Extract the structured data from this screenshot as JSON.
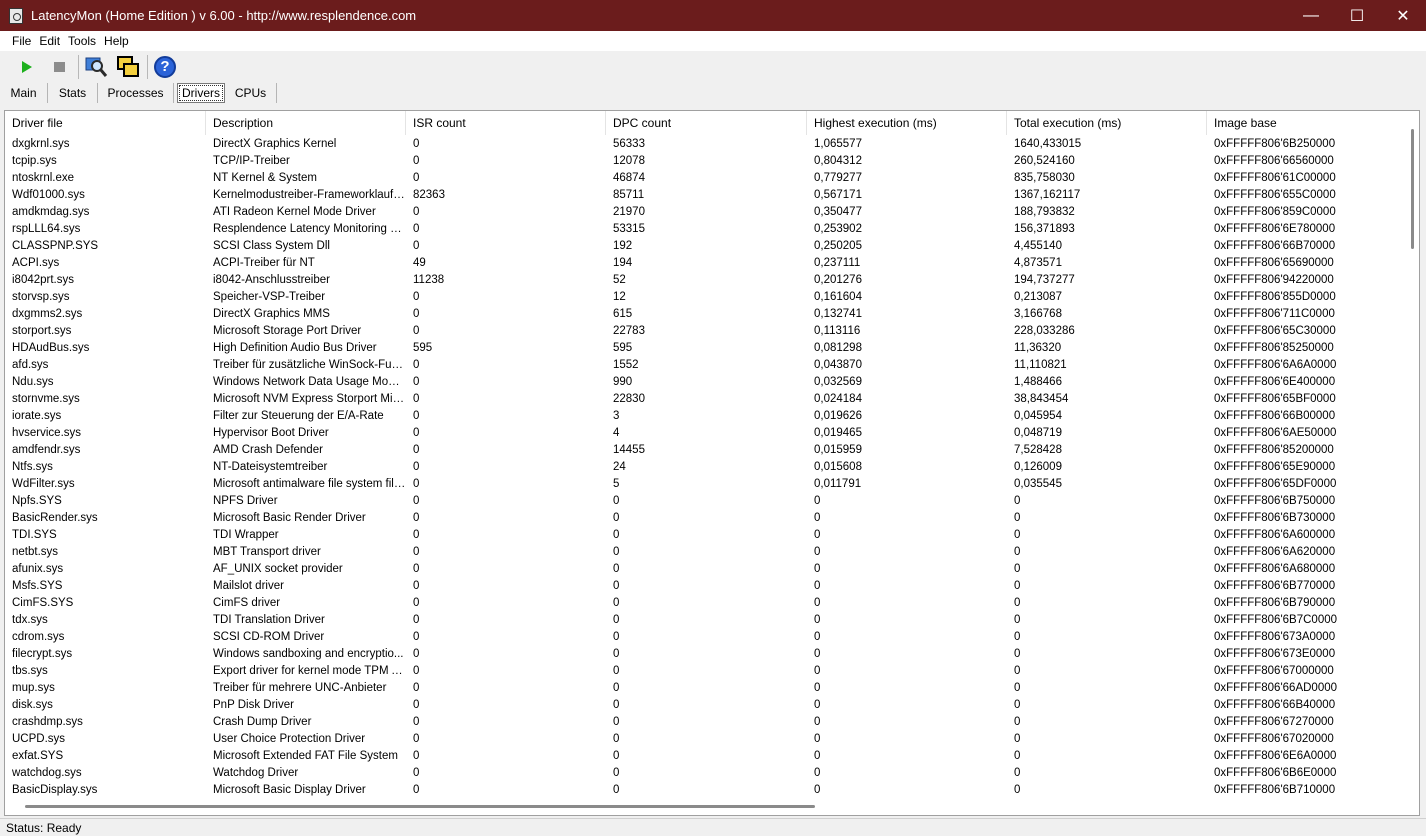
{
  "window": {
    "title": "LatencyMon  (Home Edition )  v 6.00 - http://www.resplendence.com",
    "controls": {
      "minimize": "—",
      "maximize": "☐",
      "close": "✕"
    }
  },
  "menu": [
    {
      "label": "File"
    },
    {
      "label": "Edit"
    },
    {
      "label": "Tools"
    },
    {
      "label": "Help"
    }
  ],
  "toolbar": {
    "icons": [
      "play-icon",
      "stop-icon",
      "search-icon",
      "windows-icon",
      "help-icon"
    ],
    "help_glyph": "?"
  },
  "tabs": [
    {
      "label": "Main",
      "active": false
    },
    {
      "label": "Stats",
      "active": false
    },
    {
      "label": "Processes",
      "active": false
    },
    {
      "label": "Drivers",
      "active": true
    },
    {
      "label": "CPUs",
      "active": false
    }
  ],
  "table": {
    "columns": [
      "Driver file",
      "Description",
      "ISR count",
      "DPC count",
      "Highest execution (ms)",
      "Total execution (ms)",
      "Image base"
    ],
    "rows": [
      [
        "dxgkrnl.sys",
        "DirectX Graphics Kernel",
        "0",
        "56333",
        "1,065577",
        "1640,433015",
        "0xFFFFF806'6B250000"
      ],
      [
        "tcpip.sys",
        "TCP/IP-Treiber",
        "0",
        "12078",
        "0,804312",
        "260,524160",
        "0xFFFFF806'66560000"
      ],
      [
        "ntoskrnl.exe",
        "NT Kernel & System",
        "0",
        "46874",
        "0,779277",
        "835,758030",
        "0xFFFFF806'61C00000"
      ],
      [
        "Wdf01000.sys",
        "Kernelmodustreiber-Frameworklaufzeit",
        "82363",
        "85711",
        "0,567171",
        "1367,162117",
        "0xFFFFF806'655C0000"
      ],
      [
        "amdkmdag.sys",
        "ATI Radeon Kernel Mode Driver",
        "0",
        "21970",
        "0,350477",
        "188,793832",
        "0xFFFFF806'859C0000"
      ],
      [
        "rspLLL64.sys",
        "Resplendence Latency Monitoring a...",
        "0",
        "53315",
        "0,253902",
        "156,371893",
        "0xFFFFF806'6E780000"
      ],
      [
        "CLASSPNP.SYS",
        "SCSI Class System Dll",
        "0",
        "192",
        "0,250205",
        "4,455140",
        "0xFFFFF806'66B70000"
      ],
      [
        "ACPI.sys",
        "ACPI-Treiber für NT",
        "49",
        "194",
        "0,237111",
        "4,873571",
        "0xFFFFF806'65690000"
      ],
      [
        "i8042prt.sys",
        "i8042-Anschlusstreiber",
        "11238",
        "52",
        "0,201276",
        "194,737277",
        "0xFFFFF806'94220000"
      ],
      [
        "storvsp.sys",
        "Speicher-VSP-Treiber",
        "0",
        "12",
        "0,161604",
        "0,213087",
        "0xFFFFF806'855D0000"
      ],
      [
        "dxgmms2.sys",
        "DirectX Graphics MMS",
        "0",
        "615",
        "0,132741",
        "3,166768",
        "0xFFFFF806'711C0000"
      ],
      [
        "storport.sys",
        "Microsoft Storage Port Driver",
        "0",
        "22783",
        "0,113116",
        "228,033286",
        "0xFFFFF806'65C30000"
      ],
      [
        "HDAudBus.sys",
        "High Definition Audio Bus Driver",
        "595",
        "595",
        "0,081298",
        "11,36320",
        "0xFFFFF806'85250000"
      ],
      [
        "afd.sys",
        "Treiber für zusätzliche WinSock-Fun...",
        "0",
        "1552",
        "0,043870",
        "11,110821",
        "0xFFFFF806'6A6A0000"
      ],
      [
        "Ndu.sys",
        "Windows Network Data Usage Monit...",
        "0",
        "990",
        "0,032569",
        "1,488466",
        "0xFFFFF806'6E400000"
      ],
      [
        "stornvme.sys",
        "Microsoft NVM Express Storport Mini...",
        "0",
        "22830",
        "0,024184",
        "38,843454",
        "0xFFFFF806'65BF0000"
      ],
      [
        "iorate.sys",
        "Filter zur Steuerung der E/A-Rate",
        "0",
        "3",
        "0,019626",
        "0,045954",
        "0xFFFFF806'66B00000"
      ],
      [
        "hvservice.sys",
        "Hypervisor Boot Driver",
        "0",
        "4",
        "0,019465",
        "0,048719",
        "0xFFFFF806'6AE50000"
      ],
      [
        "amdfendr.sys",
        "AMD Crash Defender",
        "0",
        "14455",
        "0,015959",
        "7,528428",
        "0xFFFFF806'85200000"
      ],
      [
        "Ntfs.sys",
        "NT-Dateisystemtreiber",
        "0",
        "24",
        "0,015608",
        "0,126009",
        "0xFFFFF806'65E90000"
      ],
      [
        "WdFilter.sys",
        "Microsoft antimalware file system filt...",
        "0",
        "5",
        "0,011791",
        "0,035545",
        "0xFFFFF806'65DF0000"
      ],
      [
        "Npfs.SYS",
        "NPFS Driver",
        "0",
        "0",
        "0",
        "0",
        "0xFFFFF806'6B750000"
      ],
      [
        "BasicRender.sys",
        "Microsoft Basic Render Driver",
        "0",
        "0",
        "0",
        "0",
        "0xFFFFF806'6B730000"
      ],
      [
        "TDI.SYS",
        "TDI Wrapper",
        "0",
        "0",
        "0",
        "0",
        "0xFFFFF806'6A600000"
      ],
      [
        "netbt.sys",
        "MBT Transport driver",
        "0",
        "0",
        "0",
        "0",
        "0xFFFFF806'6A620000"
      ],
      [
        "afunix.sys",
        "AF_UNIX socket provider",
        "0",
        "0",
        "0",
        "0",
        "0xFFFFF806'6A680000"
      ],
      [
        "Msfs.SYS",
        "Mailslot driver",
        "0",
        "0",
        "0",
        "0",
        "0xFFFFF806'6B770000"
      ],
      [
        "CimFS.SYS",
        "CimFS driver",
        "0",
        "0",
        "0",
        "0",
        "0xFFFFF806'6B790000"
      ],
      [
        "tdx.sys",
        "TDI Translation Driver",
        "0",
        "0",
        "0",
        "0",
        "0xFFFFF806'6B7C0000"
      ],
      [
        "cdrom.sys",
        "SCSI CD-ROM Driver",
        "0",
        "0",
        "0",
        "0",
        "0xFFFFF806'673A0000"
      ],
      [
        "filecrypt.sys",
        "Windows sandboxing and encryptio...",
        "0",
        "0",
        "0",
        "0",
        "0xFFFFF806'673E0000"
      ],
      [
        "tbs.sys",
        "Export driver for kernel mode TPM API",
        "0",
        "0",
        "0",
        "0",
        "0xFFFFF806'67000000"
      ],
      [
        "mup.sys",
        "Treiber für mehrere UNC-Anbieter",
        "0",
        "0",
        "0",
        "0",
        "0xFFFFF806'66AD0000"
      ],
      [
        "disk.sys",
        "PnP Disk Driver",
        "0",
        "0",
        "0",
        "0",
        "0xFFFFF806'66B40000"
      ],
      [
        "crashdmp.sys",
        "Crash Dump Driver",
        "0",
        "0",
        "0",
        "0",
        "0xFFFFF806'67270000"
      ],
      [
        "UCPD.sys",
        "User Choice Protection Driver",
        "0",
        "0",
        "0",
        "0",
        "0xFFFFF806'67020000"
      ],
      [
        "exfat.SYS",
        "Microsoft Extended FAT File System",
        "0",
        "0",
        "0",
        "0",
        "0xFFFFF806'6E6A0000"
      ],
      [
        "watchdog.sys",
        "Watchdog Driver",
        "0",
        "0",
        "0",
        "0",
        "0xFFFFF806'6B6E0000"
      ],
      [
        "BasicDisplay.sys",
        "Microsoft Basic Display Driver",
        "0",
        "0",
        "0",
        "0",
        "0xFFFFF806'6B710000"
      ]
    ]
  },
  "status": {
    "text": "Status: Ready"
  }
}
